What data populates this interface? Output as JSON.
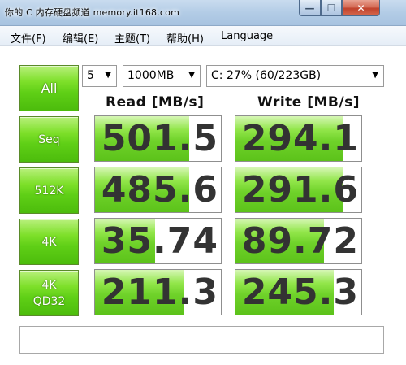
{
  "window": {
    "title": "你的 C 内存硬盘频道 memory.it168.com",
    "min_glyph": "—",
    "max_glyph": "☐",
    "close_glyph": "✕"
  },
  "menu": {
    "items": [
      "文件(F)",
      "编辑(E)",
      "主题(T)",
      "帮助(H)",
      "Language"
    ]
  },
  "controls": {
    "all_label": "All",
    "count": "5",
    "size": "1000MB",
    "drive": "C: 27% (60/223GB)"
  },
  "headers": {
    "read": "Read [MB/s]",
    "write": "Write [MB/s]"
  },
  "tests": [
    {
      "label": "Seq",
      "read": "501.5",
      "write": "294.1",
      "read_fill": 0.75,
      "write_fill": 0.86
    },
    {
      "label": "512K",
      "read": "485.6",
      "write": "291.6",
      "read_fill": 0.75,
      "write_fill": 0.86
    },
    {
      "label": "4K",
      "read": "35.74",
      "write": "89.72",
      "read_fill": 0.48,
      "write_fill": 0.7
    },
    {
      "label": "4K\nQD32",
      "read": "211.3",
      "write": "245.3",
      "read_fill": 0.7,
      "write_fill": 0.78
    }
  ],
  "comment": {
    "value": ""
  },
  "colors": {
    "button_green": "#5fcf16",
    "bar_green": "#6fd22a",
    "value_text": "#333333"
  }
}
